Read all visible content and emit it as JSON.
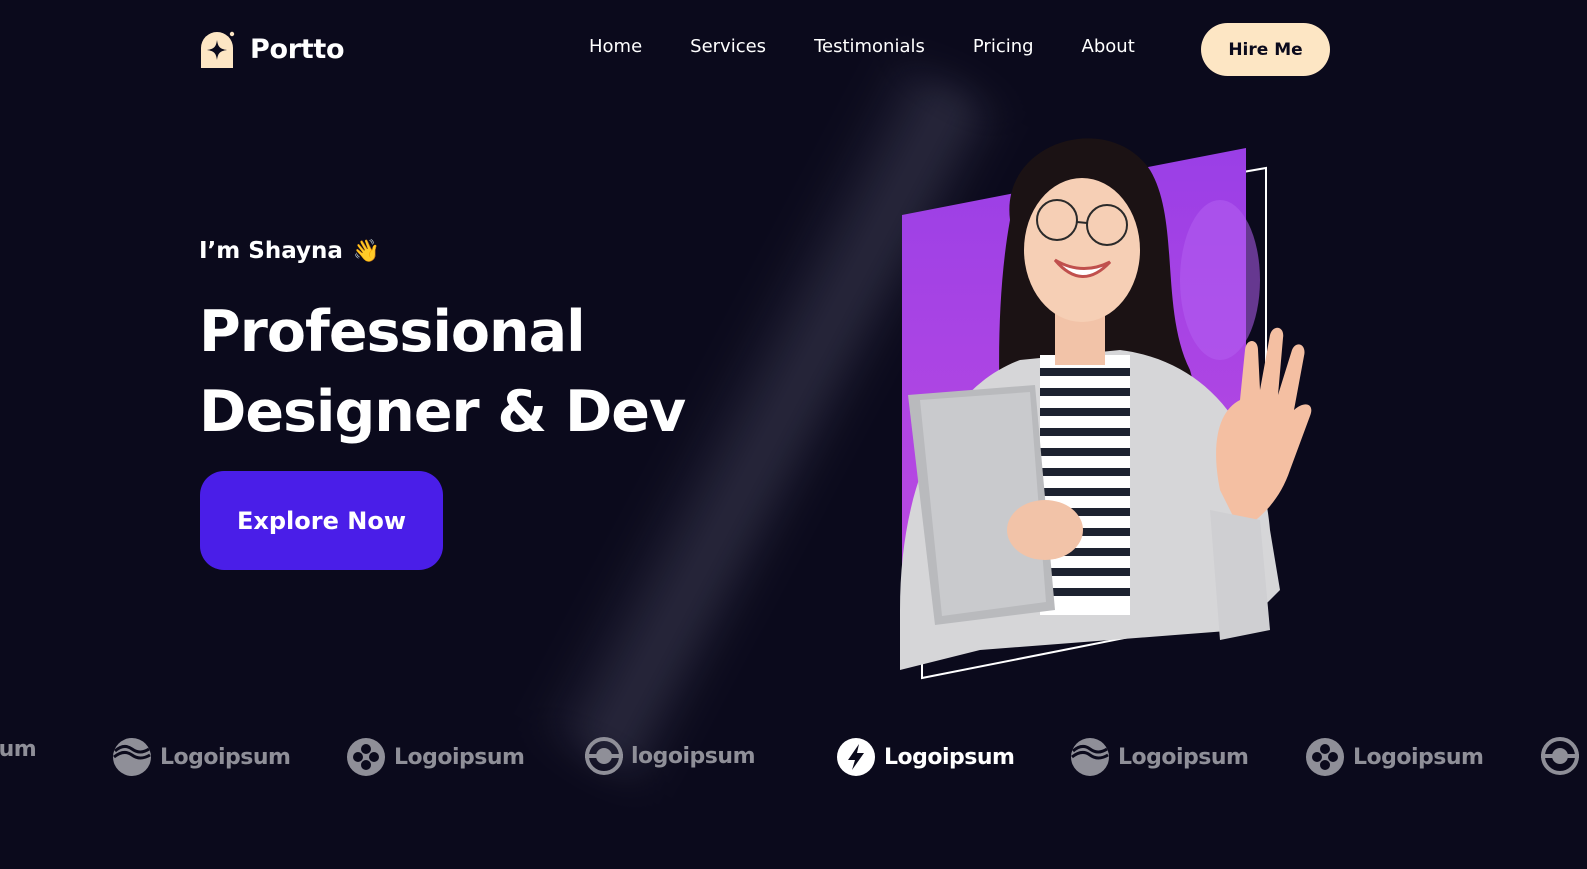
{
  "brand": {
    "name": "Portto",
    "logo_icon": "sparkle-house-icon",
    "accent": "#fde6c4"
  },
  "nav": {
    "items": [
      "Home",
      "Services",
      "Testimonials",
      "Pricing",
      "About"
    ],
    "cta_label": "Hire Me"
  },
  "hero": {
    "greeting": "I’m Shayna",
    "greeting_icon": "👋",
    "headline_line1": "Professional",
    "headline_line2": "Designer & Dev",
    "cta_label": "Explore Now",
    "cta_color": "#4a1ee8",
    "portrait_icon": "woman-waving-portrait",
    "portrait_accent": "#9a3fe6"
  },
  "logos": [
    {
      "label": "sum",
      "icon": "none",
      "active": false
    },
    {
      "label": "Logoipsum",
      "icon": "waves-circle-icon",
      "active": false
    },
    {
      "label": "Logoipsum",
      "icon": "four-dots-circle-icon",
      "active": false
    },
    {
      "label": "logoipsum",
      "icon": "ring-eye-icon",
      "active": false
    },
    {
      "label": "Logoipsum",
      "icon": "lightning-circle-icon",
      "active": true
    },
    {
      "label": "Logoipsum",
      "icon": "waves-circle-icon",
      "active": false
    },
    {
      "label": "Logoipsum",
      "icon": "four-dots-circle-icon",
      "active": false
    },
    {
      "label": "",
      "icon": "ring-eye-icon",
      "active": false
    }
  ],
  "colors": {
    "background": "#0b0a1c",
    "text": "#ffffff",
    "muted_logo": "#8f8f98"
  }
}
